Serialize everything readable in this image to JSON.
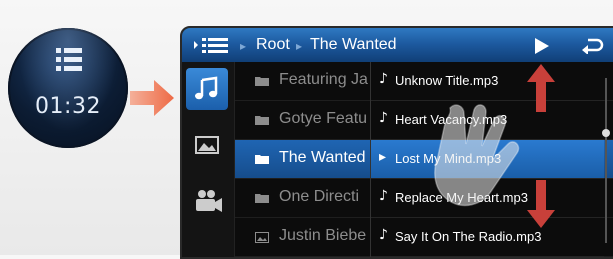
{
  "callout": {
    "clock_text": "01:32",
    "icon": "list-icon"
  },
  "header": {
    "breadcrumb": [
      "Root",
      "The Wanted"
    ],
    "menu_icon": "list-icon",
    "play_icon": "play-icon",
    "back_icon": "back-icon"
  },
  "sidebar": {
    "items": [
      {
        "name": "music",
        "icon": "music-note-icon",
        "active": true
      },
      {
        "name": "photos",
        "icon": "image-icon",
        "active": false
      },
      {
        "name": "videos",
        "icon": "video-camera-icon",
        "active": false
      }
    ]
  },
  "folders": {
    "items": [
      {
        "label": "Featuring Ja",
        "icon": "folder-icon"
      },
      {
        "label": "Gotye Featu",
        "icon": "folder-icon"
      },
      {
        "label": "The Wanted",
        "icon": "folder-icon",
        "selected": true
      },
      {
        "label": "One Directi",
        "icon": "folder-icon"
      },
      {
        "label": "Justin Biebe",
        "icon": "image-icon"
      }
    ]
  },
  "songs": {
    "items": [
      {
        "label": "Unknow Title.mp3"
      },
      {
        "label": "Heart Vacancy.mp3"
      },
      {
        "label": "Lost My Mind.mp3",
        "selected": true
      },
      {
        "label": "Replace My Heart.mp3"
      },
      {
        "label": "Say It On The Radio.mp3"
      }
    ]
  },
  "colors": {
    "accent_blue": "#1f65b3",
    "arrow_red": "#c8403a",
    "callout_arrow": "#ee7a57"
  }
}
